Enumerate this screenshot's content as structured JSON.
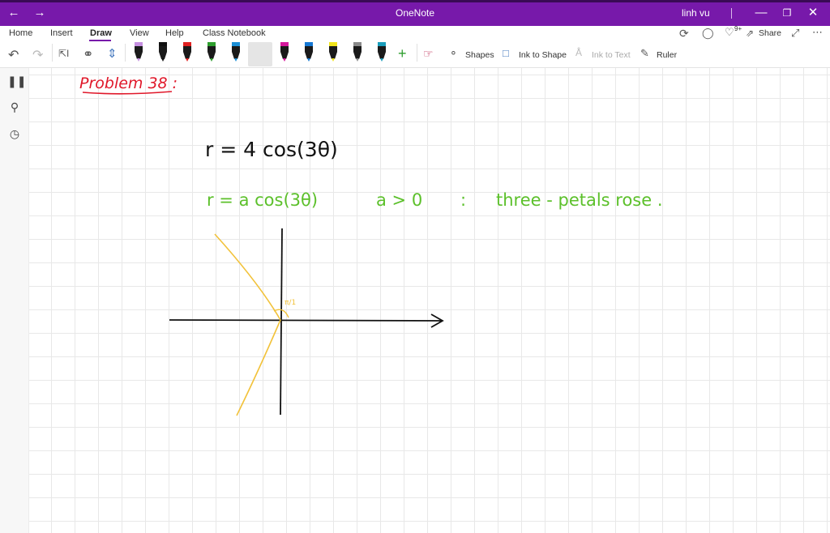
{
  "window": {
    "title": "OneNote",
    "user": "linh vu"
  },
  "tabs": [
    {
      "label": "Home"
    },
    {
      "label": "Insert"
    },
    {
      "label": "Draw"
    },
    {
      "label": "View"
    },
    {
      "label": "Help"
    },
    {
      "label": "Class Notebook"
    }
  ],
  "ribbon": {
    "share_label": "Share",
    "shapes_label": "Shapes",
    "ink_to_shape_label": "Ink to Shape",
    "ink_to_text_label": "Ink to Text",
    "ruler_label": "Ruler",
    "notification_badge": "9+"
  },
  "pens": [
    {
      "color": "#c58fe0"
    },
    {
      "color": "#111111"
    },
    {
      "color": "#e02020"
    },
    {
      "color": "#2e9e2e"
    },
    {
      "color": "#1b8fd6"
    },
    {
      "color": "#f5c400"
    },
    {
      "color": "#d6179c"
    },
    {
      "color": "#1578d4"
    },
    {
      "color": "#f0e41a"
    },
    {
      "color": "#8a8a8a"
    },
    {
      "color": "#1a9dbb"
    }
  ],
  "note": {
    "heading": "Problem 38 :",
    "equation": "r = 4 cos(3θ)",
    "general_form": "r = a cos(3θ)",
    "condition": "a > 0",
    "colon": ":",
    "description": "three - petals rose .",
    "angle_label": "π/1"
  },
  "colors": {
    "accent": "#7719aa",
    "red_ink": "#e0182a",
    "green_ink": "#5cc02b",
    "yellow_ink": "#f2c23a",
    "black_ink": "#111111"
  }
}
